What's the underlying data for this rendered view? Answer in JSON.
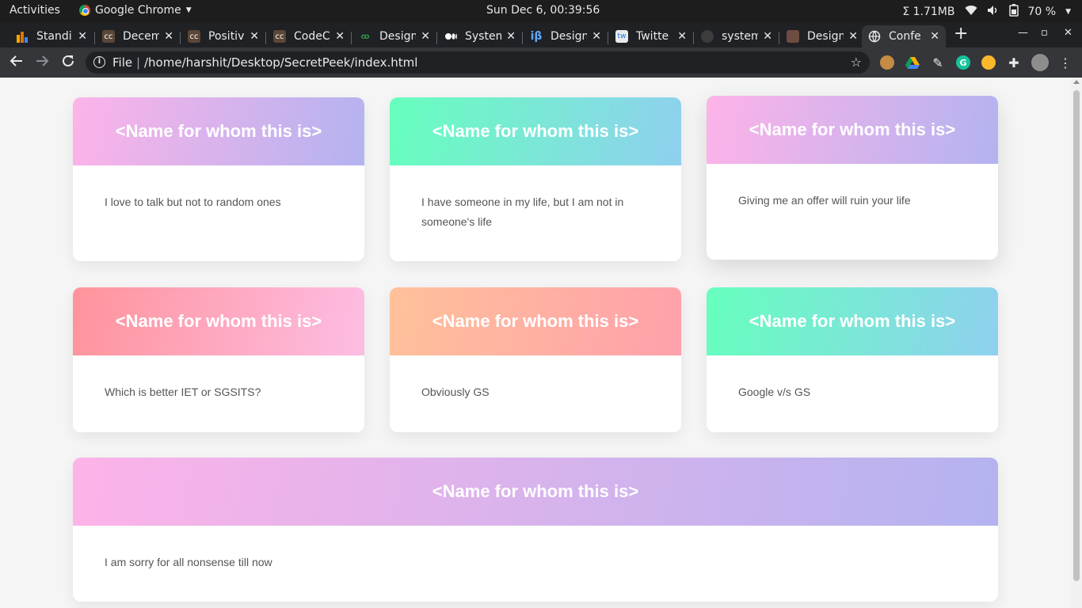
{
  "topbar": {
    "activities": "Activities",
    "app_name": "Google Chrome",
    "clock": "Sun Dec  6, 00:39:56",
    "mem": "Σ 1.71MB",
    "battery": "70 %"
  },
  "tabs": [
    {
      "title": "Standi",
      "icon": "chart-favicon",
      "color": "#e37400"
    },
    {
      "title": "Decem",
      "icon": "codechef-favicon",
      "color": "#5b4638"
    },
    {
      "title": "Positiv",
      "icon": "codechef-favicon",
      "color": "#5b4638"
    },
    {
      "title": "CodeC",
      "icon": "codechef-favicon",
      "color": "#5b4638"
    },
    {
      "title": "Design",
      "icon": "geeksforgeeks-favicon",
      "color": "#2f8d46"
    },
    {
      "title": "System",
      "icon": "medium-favicon",
      "color": "#000000"
    },
    {
      "title": "Design",
      "icon": "interviewbit-favicon",
      "color": "#1a73e8"
    },
    {
      "title": "Twitte",
      "icon": "twitter-favicon",
      "color": "#e8eaed"
    },
    {
      "title": "system",
      "icon": "github-favicon",
      "color": "#202124"
    },
    {
      "title": "Design",
      "icon": "avatar-favicon",
      "color": "#6d4c41"
    },
    {
      "title": "Confe",
      "icon": "globe-favicon",
      "color": "#9aa0a6",
      "active": true
    }
  ],
  "toolbar": {
    "file_label": "File",
    "url": "/home/harshit/Desktop/SecretPeek/index.html"
  },
  "cards": [
    {
      "name": "<Name for whom this is>",
      "message": "I love to talk but not to random ones"
    },
    {
      "name": "<Name for whom this is>",
      "message": "I have someone in my life, but I am not in someone's life"
    },
    {
      "name": "<Name for whom this is>",
      "message": "Giving me an offer will ruin your life"
    },
    {
      "name": "<Name for whom this is>",
      "message": "Which is better IET or SGSITS?"
    },
    {
      "name": "<Name for whom this is>",
      "message": "Obviously GS"
    },
    {
      "name": "<Name for whom this is>",
      "message": "Google v/s GS"
    },
    {
      "name": "<Name for whom this is>",
      "message": "I am sorry for all nonsense till now"
    }
  ],
  "colors": {
    "pink_purple": [
      "#fdb3e8",
      "#b3b3f0"
    ],
    "green_blue": [
      "#66ffbd",
      "#8fd0ef"
    ],
    "red_pink": [
      "#ff939b",
      "#fdbde3"
    ],
    "peach_pink": [
      "#ffc19a",
      "#ffa0ab"
    ]
  }
}
